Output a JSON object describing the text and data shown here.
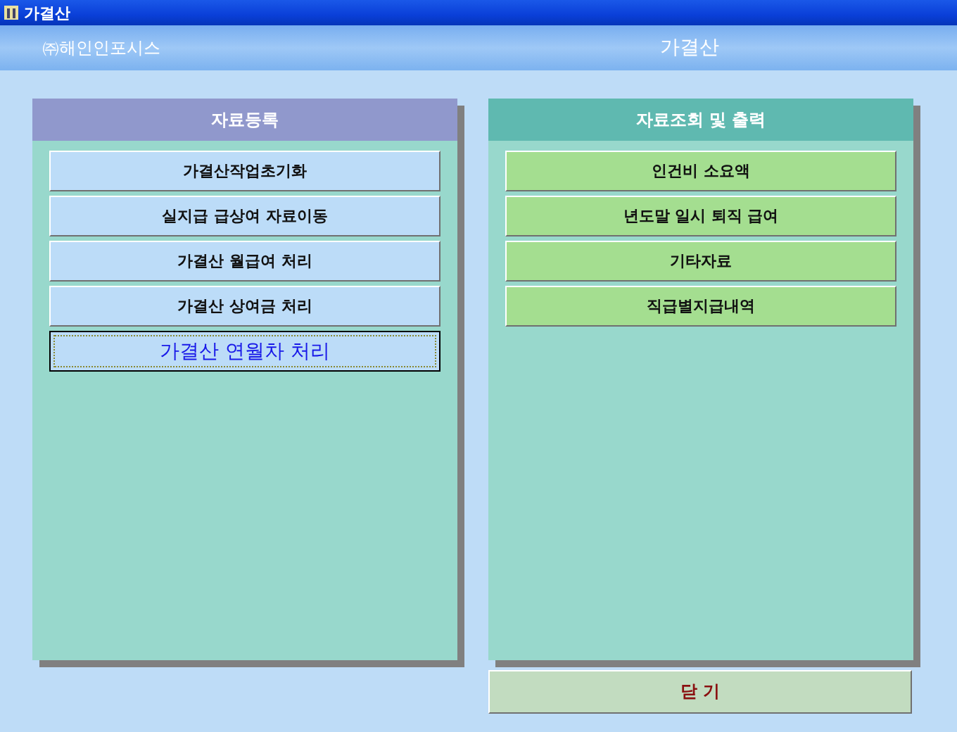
{
  "window": {
    "title": "가결산"
  },
  "header": {
    "company": "㈜해인인포시스",
    "title": "가결산"
  },
  "panels": [
    {
      "title": "자료등록",
      "kind": "register",
      "buttons": [
        {
          "label": "가결산작업초기화",
          "selected": false
        },
        {
          "label": "실지급 급상여 자료이동",
          "selected": false
        },
        {
          "label": "가결산 월급여 처리",
          "selected": false
        },
        {
          "label": "가결산 상여금 처리",
          "selected": false
        },
        {
          "label": "가결산 연월차 처리",
          "selected": true
        }
      ]
    },
    {
      "title": "자료조회 및 출력",
      "kind": "report",
      "buttons": [
        {
          "label": "인건비 소요액",
          "selected": false
        },
        {
          "label": "년도말 일시 퇴직 급여",
          "selected": false
        },
        {
          "label": "기타자료",
          "selected": false
        },
        {
          "label": "직급별지급내역",
          "selected": false
        }
      ]
    }
  ],
  "close_button": "닫 기"
}
